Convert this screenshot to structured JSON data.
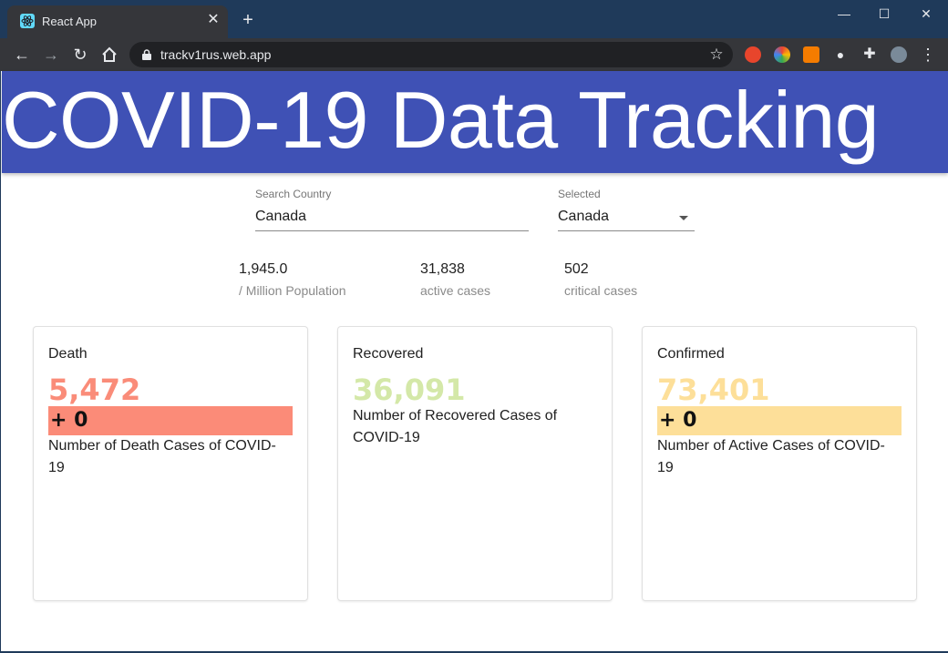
{
  "browser": {
    "tab_title": "React App",
    "url": "trackv1rus.web.app"
  },
  "app": {
    "title": "COVID-19 Data Tracking"
  },
  "search": {
    "label": "Search Country",
    "value": "Canada"
  },
  "selected": {
    "label": "Selected",
    "value": "Canada"
  },
  "stats": [
    {
      "value": "1,945.0",
      "label": "/ Million Population"
    },
    {
      "value": "31,838",
      "label": "active cases"
    },
    {
      "value": "502",
      "label": "critical cases"
    }
  ],
  "cards": [
    {
      "title": "Death",
      "number": "5,472",
      "delta": "+ 0",
      "description": "Number of Death Cases of COVID-19",
      "color": "#fa8c79",
      "bar_color": "#fb8b78"
    },
    {
      "title": "Recovered",
      "number": "36,091",
      "description": "Number of Recovered Cases of COVID-19",
      "color": "#d4e8a8"
    },
    {
      "title": "Confirmed",
      "number": "73,401",
      "delta": "+ 0",
      "description": "Number of Active Cases of COVID-19",
      "color": "#fddf99",
      "bar_color": "#fddf99"
    }
  ],
  "colors": {
    "header": "#3f51b5",
    "browser_frame": "#1f3a5a"
  }
}
